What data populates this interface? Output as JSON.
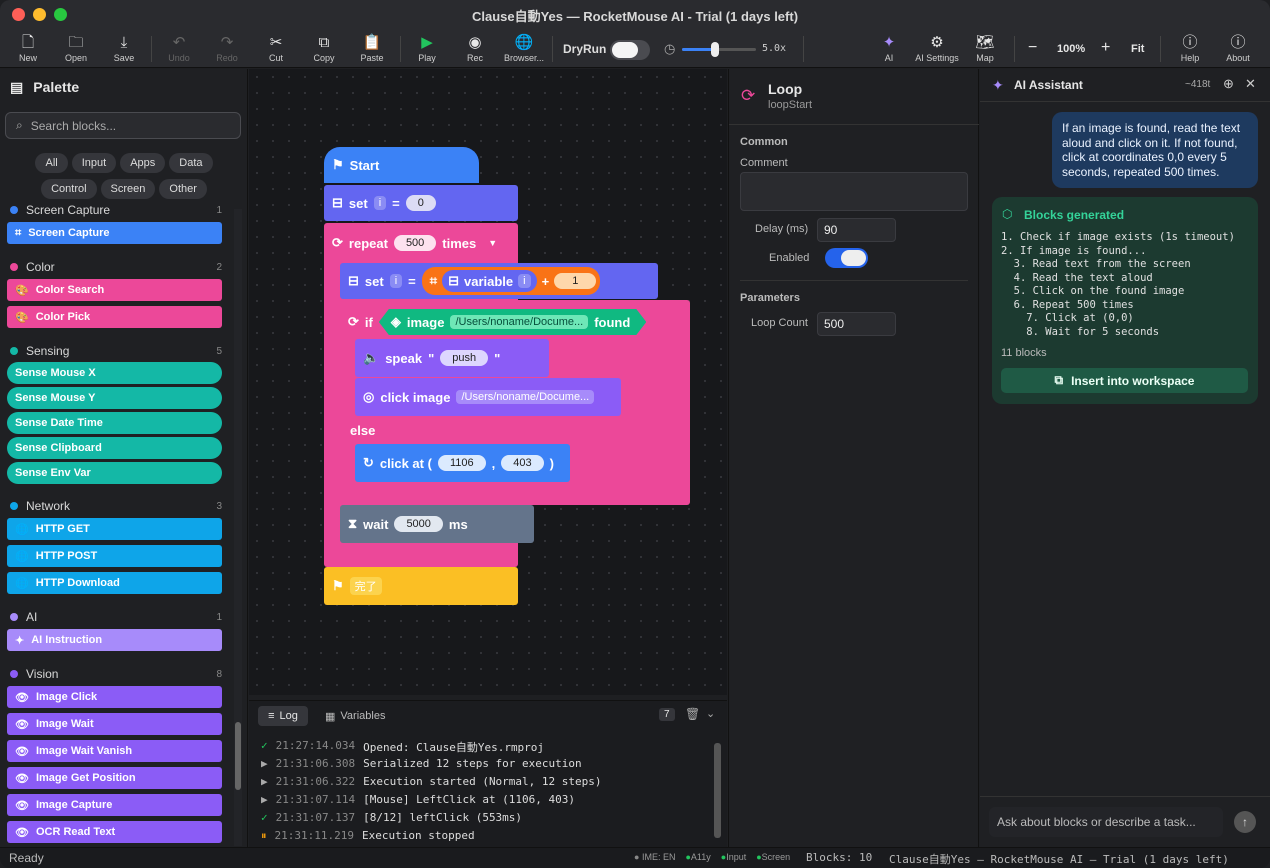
{
  "window": {
    "title": "Clause自動Yes — RocketMouse AI - Trial (1 days left)"
  },
  "toolbar": {
    "new": "New",
    "open": "Open",
    "save": "Save",
    "undo": "Undo",
    "redo": "Redo",
    "cut": "Cut",
    "copy": "Copy",
    "paste": "Paste",
    "play": "Play",
    "rec": "Rec",
    "browser": "Browser...",
    "dryrun": "DryRun",
    "speed": "5.0x",
    "ai": "AI",
    "ai_settings": "AI Settings",
    "map": "Map",
    "zoom": "100%",
    "fit": "Fit",
    "help": "Help",
    "about": "About"
  },
  "palette": {
    "title": "Palette",
    "search_placeholder": "Search blocks...",
    "chips": [
      "All",
      "Input",
      "Apps",
      "Data",
      "Control",
      "Screen",
      "Other"
    ],
    "categories": [
      {
        "name": "Screen Capture",
        "count": "1",
        "color": "#3b82f6",
        "items": [
          "Screen Capture"
        ]
      },
      {
        "name": "Color",
        "count": "2",
        "color": "#ec4899",
        "items": [
          "Color Search",
          "Color Pick"
        ]
      },
      {
        "name": "Sensing",
        "count": "5",
        "color": "#14b8a6",
        "items": [
          "Sense Mouse X",
          "Sense Mouse Y",
          "Sense Date Time",
          "Sense Clipboard",
          "Sense Env Var"
        ]
      },
      {
        "name": "Network",
        "count": "3",
        "color": "#0ea5e9",
        "items": [
          "HTTP GET",
          "HTTP POST",
          "HTTP Download"
        ]
      },
      {
        "name": "AI",
        "count": "1",
        "color": "#a78bfa",
        "items": [
          "AI Instruction"
        ]
      },
      {
        "name": "Vision",
        "count": "8",
        "color": "#8b5cf6",
        "items": [
          "Image Click",
          "Image Wait",
          "Image Wait Vanish",
          "Image Get Position",
          "Image Capture",
          "OCR Read Text"
        ]
      }
    ]
  },
  "blocks": {
    "start": "Start",
    "set1": "set",
    "var_i": "i",
    "eq": "=",
    "zero": "0",
    "repeat": "repeat",
    "repeat_count": "500",
    "times": "times",
    "set2": "set",
    "variable": "variable",
    "plus": "+",
    "one": "1",
    "if": "if",
    "image": "image",
    "image_path": "/Users/noname/Docume...",
    "found": "found",
    "speak": "speak",
    "speak_q1": "\"",
    "speak_text": "push",
    "speak_q2": "\"",
    "click_image": "click image",
    "click_image_path": "/Users/noname/Docume...",
    "else": "else",
    "click_at": "click at (",
    "click_x": "1106",
    "comma": ",",
    "click_y": "403",
    "close_paren": ")",
    "wait": "wait",
    "wait_ms": "5000",
    "ms": "ms",
    "end": "完了"
  },
  "inspector": {
    "title": "Loop",
    "subtitle": "loopStart",
    "common": "Common",
    "comment_label": "Comment",
    "comment_value": "",
    "delay_label": "Delay (ms)",
    "delay_value": "90",
    "enabled_label": "Enabled",
    "enabled": true,
    "parameters": "Parameters",
    "loop_count_label": "Loop Count",
    "loop_count_value": "500"
  },
  "ai": {
    "title": "AI Assistant",
    "tokens": "~418t",
    "user_message": "If an image is found, read the text aloud and click on it. If not found, click at coordinates 0,0 every 5 seconds, repeated 500 times.",
    "generated_title": "Blocks generated",
    "steps": [
      "1. Check if image exists (1s timeout)",
      "2. If image is found...",
      "  3. Read text from the screen",
      "  4. Read the text aloud",
      "  5. Click on the found image",
      "  6. Repeat 500 times",
      "    7. Click at (0,0)",
      "    8. Wait for 5 seconds"
    ],
    "block_count": "11 blocks",
    "insert": "Insert into workspace",
    "input_placeholder": "Ask about blocks or describe a task..."
  },
  "log": {
    "tab_log": "Log",
    "tab_variables": "Variables",
    "count": "7",
    "lines": [
      {
        "status": "✓",
        "time": "21:27:14.034",
        "msg": "Opened: Clause自動Yes.rmproj"
      },
      {
        "status": "▶",
        "time": "21:31:06.308",
        "msg": "Serialized 12 steps for execution"
      },
      {
        "status": "▶",
        "time": "21:31:06.322",
        "msg": "Execution started (Normal, 12 steps)"
      },
      {
        "status": "▶",
        "time": "21:31:07.114",
        "msg": "[Mouse] LeftClick at (1106, 403)"
      },
      {
        "status": "✓",
        "time": "21:31:07.137",
        "msg": "[8/12] leftClick (553ms)"
      },
      {
        "status": "⏸",
        "time": "21:31:11.219",
        "msg": "Execution stopped"
      }
    ]
  },
  "status": {
    "ready": "Ready",
    "ime": "IME: EN",
    "a11y": "A11y",
    "input": "Input",
    "screen": "Screen",
    "blocks": "Blocks: 10",
    "title": "Clause自動Yes — RocketMouse AI — Trial (1 days left)"
  }
}
